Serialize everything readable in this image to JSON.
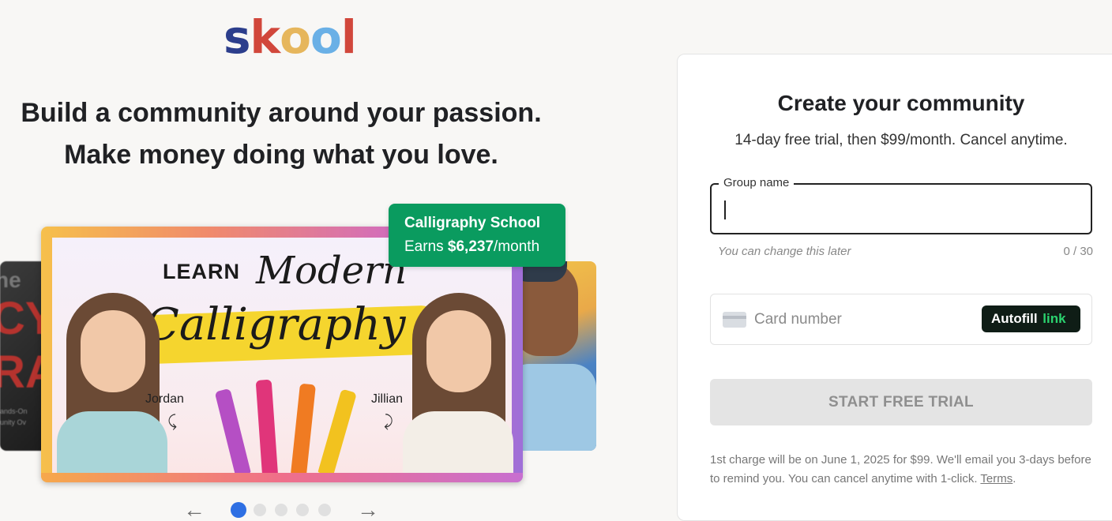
{
  "logo": {
    "letters": [
      {
        "char": "s",
        "color": "#2c3e8c"
      },
      {
        "char": "k",
        "color": "#d1473b"
      },
      {
        "char": "o",
        "color": "#e6b65c"
      },
      {
        "char": "o",
        "color": "#6ab0e6"
      },
      {
        "char": "l",
        "color": "#d1473b"
      }
    ]
  },
  "hero": {
    "line1": "Build a community around your passion.",
    "line2": "Make money doing what you love."
  },
  "carousel": {
    "badge": {
      "name": "Calligraphy School",
      "earns_prefix": "Earns ",
      "earns_amount": "$6,237",
      "earns_suffix": "/month"
    },
    "card": {
      "learn": "LEARN",
      "modern": "Modern",
      "calligraphy": "Calligraphy",
      "left_name": "Jordan",
      "right_name": "Jillian"
    },
    "left_card": {
      "t1": "ne",
      "t2": "CY",
      "t3": "RA",
      "t4": "ands-On\nunity Ov"
    },
    "active_index": 0,
    "dot_count": 5,
    "prev_icon": "arrow-left-icon",
    "next_icon": "arrow-right-icon",
    "prev_glyph": "←",
    "next_glyph": "→"
  },
  "form": {
    "title": "Create your community",
    "subtitle": "14-day free trial, then $99/month. Cancel anytime.",
    "group_name": {
      "label": "Group name",
      "value": "",
      "hint": "You can change this later",
      "count": "0 / 30"
    },
    "card_number": {
      "placeholder": "Card number",
      "autofill_label": "Autofill",
      "autofill_link": "link"
    },
    "submit_label": "START FREE TRIAL",
    "disclaimer": "1st charge will be on June 1, 2025 for $99. We'll email you 3-days before to remind you. You can cancel anytime with 1-click.",
    "terms_label": "Terms",
    "terms_suffix": "."
  },
  "colors": {
    "badge_bg": "#0a9b5f",
    "active_dot": "#2e6fe3",
    "autofill_bg": "#0f1d16",
    "autofill_link": "#2bd36f"
  }
}
